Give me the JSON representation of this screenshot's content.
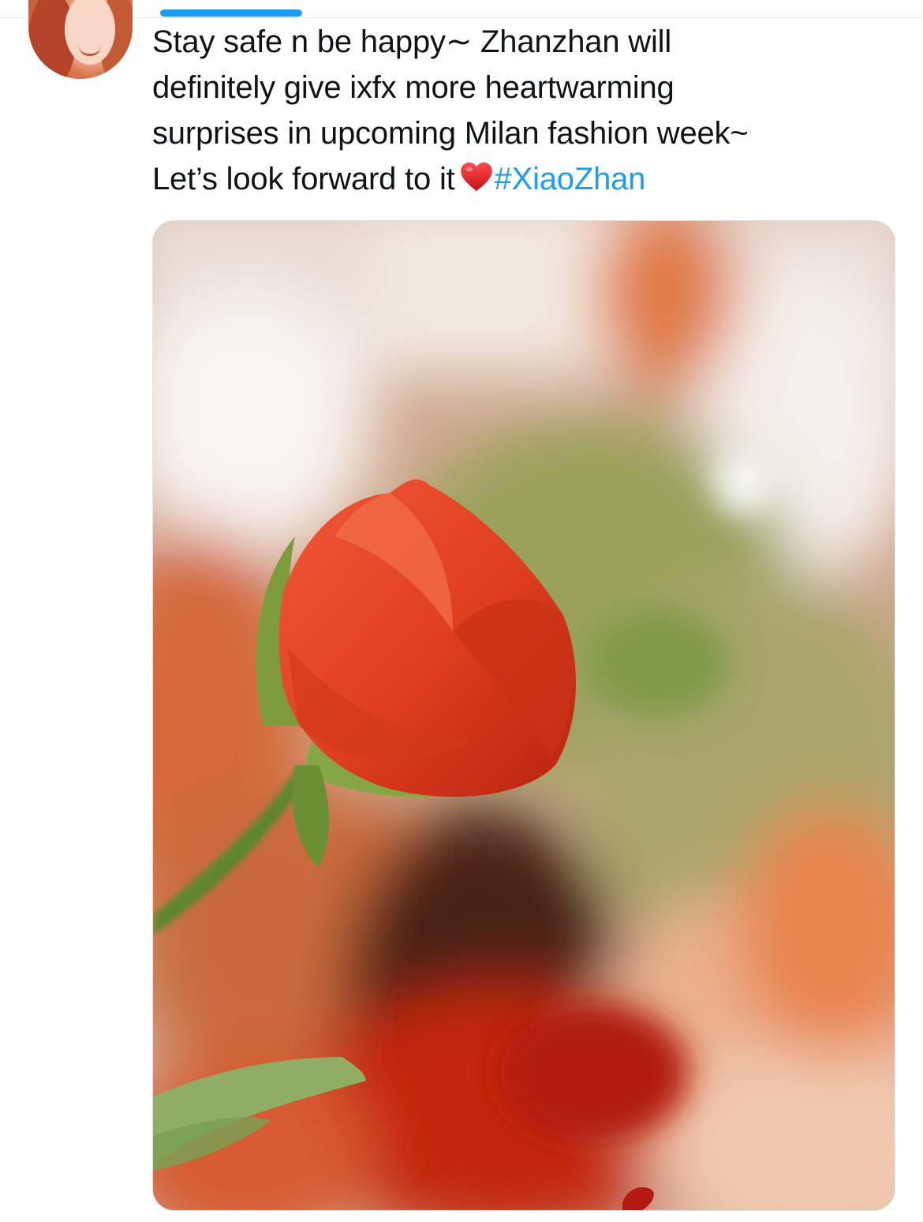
{
  "tweet": {
    "lines": [
      "Stay safe n be happy∼ Zhanzhan will",
      "definitely give ixfx more heartwarming",
      "surprises in upcoming Milan fashion week~",
      "Let’s look forward to it"
    ],
    "emoji": "heart-icon",
    "hashtag": "#XiaoZhan"
  },
  "media": {
    "subject": "red-rose-photo"
  },
  "colors": {
    "text": "#0f1419",
    "link": "#1d9bf0",
    "heart": "#e0242f"
  }
}
